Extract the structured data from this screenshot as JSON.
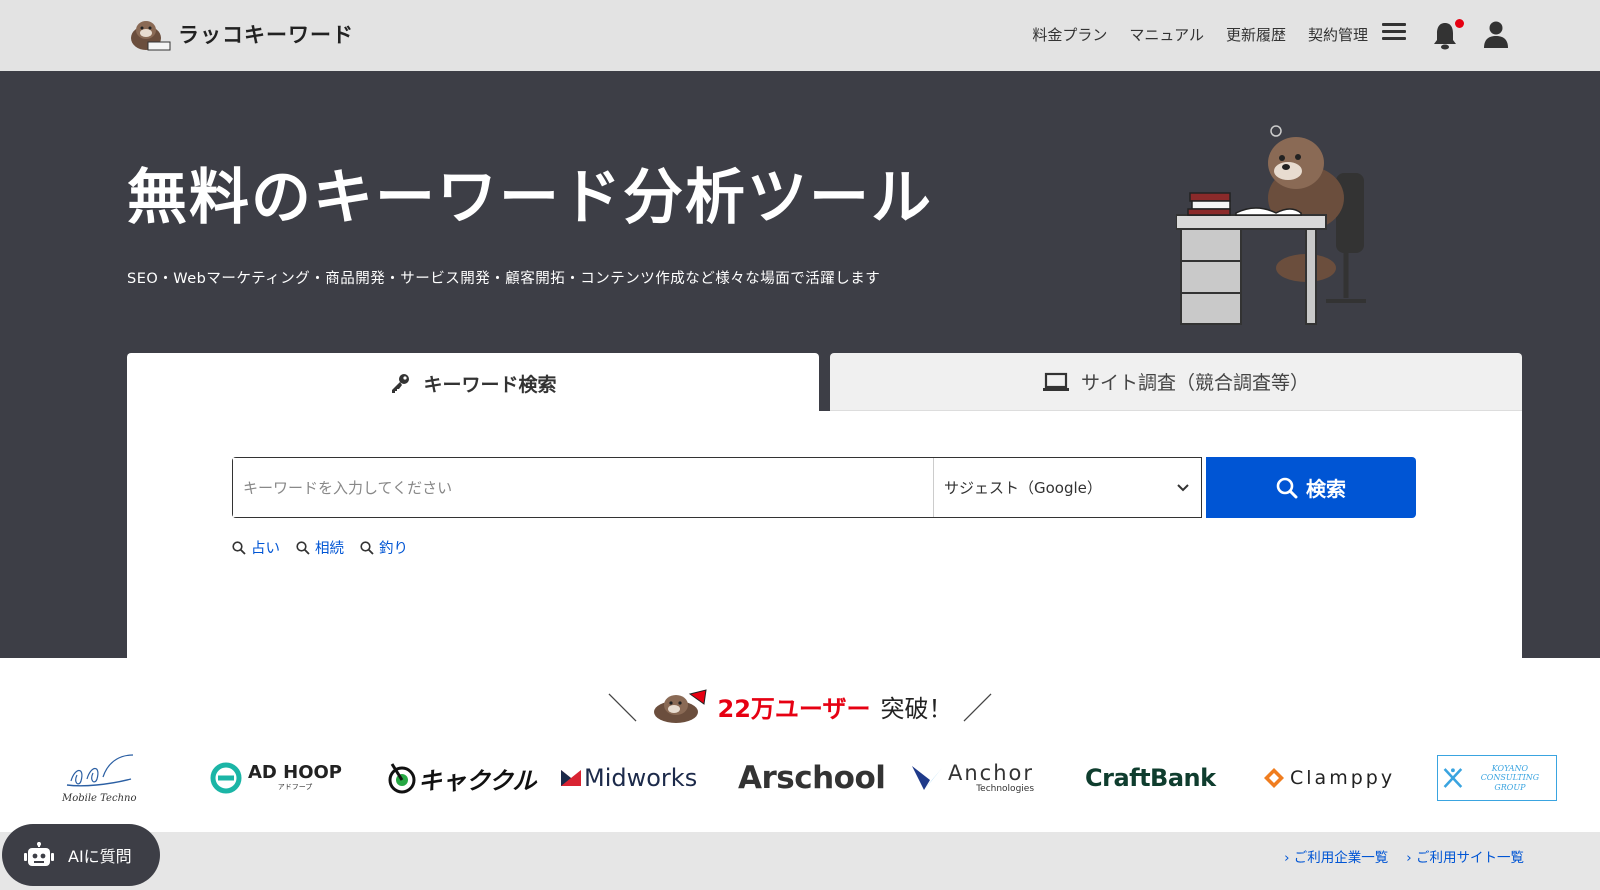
{
  "header": {
    "logo_text": "ラッコキーワード",
    "nav": [
      "料金プラン",
      "マニュアル",
      "更新履歴",
      "契約管理"
    ]
  },
  "hero": {
    "title": "無料のキーワード分析ツール",
    "subtitle": "SEO・Webマーケティング・商品開発・サービス開発・顧客開拓・コンテンツ作成など様々な場面で活躍します"
  },
  "tabs": {
    "keyword": "キーワード検索",
    "site": "サイト調査（競合調査等）"
  },
  "search": {
    "placeholder": "キーワードを入力してください",
    "select_value": "サジェスト（Google）",
    "button": "検索",
    "suggestions": [
      "占い",
      "相続",
      "釣り"
    ]
  },
  "users": {
    "count": "22万ユーザー",
    "suffix": "突破！"
  },
  "logos": [
    "Mobile Techno",
    "AD HOOP",
    "キャククル",
    "Midworks",
    "Arschool",
    "Anchor",
    "CraftBank",
    "Clamppy",
    "KOYANO CONSULTING GROUP"
  ],
  "logo_subtext": {
    "adhoop": "アドフープ",
    "anchor": "Technologies"
  },
  "footer": {
    "ai_button": "AIに質問",
    "links": [
      "ご利用企業一覧",
      "ご利用サイト一覧"
    ]
  },
  "colors": {
    "hero_bg": "#3d3e46",
    "primary": "#0055d4",
    "accent_red": "#e60012"
  }
}
